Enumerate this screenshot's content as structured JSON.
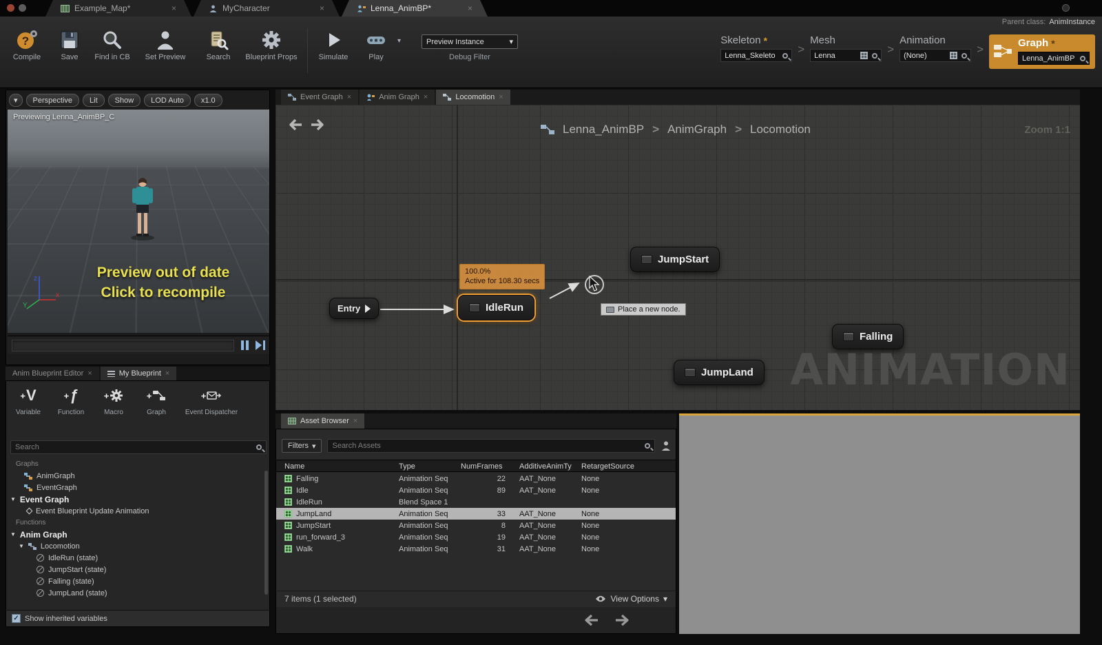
{
  "glyphs": {
    "close": "×",
    "caret": "▾",
    "expand": "▼",
    "chevron": ">",
    "asterisk": "*",
    "check": "✓"
  },
  "colors": {
    "accent_orange": "#cf8c2f",
    "node_active_border": "#ef9e36",
    "warning_yellow": "#e8e04e",
    "selected_row_gray": "#b5b5b5",
    "asset_icon_green": "#2e6b2e"
  },
  "window": {
    "tabs": [
      {
        "label": "Example_Map*"
      },
      {
        "label": "MyCharacter"
      },
      {
        "label": "Lenna_AnimBP*"
      }
    ],
    "parent_class_label": "Parent class:",
    "parent_class_value": "AnimInstance"
  },
  "toolbar": {
    "buttons": [
      "Compile",
      "Save",
      "Find in CB",
      "Set Preview",
      "Search",
      "Blueprint Props",
      "Simulate",
      "Play"
    ],
    "preview_instance": "Preview Instance",
    "debug_filter": "Debug Filter",
    "chain": {
      "skeleton": {
        "label": "Skeleton",
        "value": "Lenna_Skeleto"
      },
      "mesh": {
        "label": "Mesh",
        "value": "Lenna"
      },
      "animation": {
        "label": "Animation",
        "value": "(None)"
      },
      "graph": {
        "label": "Graph",
        "value": "Lenna_AnimBP"
      }
    }
  },
  "viewport": {
    "buttons": [
      "Perspective",
      "Lit",
      "Show",
      "LOD Auto",
      "x1.0"
    ],
    "previewing": "Previewing Lenna_AnimBP_C",
    "warning_line1": "Preview out of date",
    "warning_line2": "Click to recompile",
    "axis": {
      "x": "x",
      "y": "Y",
      "z": "z"
    }
  },
  "myblueprint": {
    "tabs": [
      "Anim Blueprint Editor",
      "My Blueprint"
    ],
    "actions": [
      "Variable",
      "Function",
      "Macro",
      "Graph",
      "Event Dispatcher"
    ],
    "action_glyphs": {
      "variable": "V",
      "function": "ƒ"
    },
    "search_placeholder": "Search",
    "tree": [
      {
        "label": "Graphs"
      },
      {
        "label": "AnimGraph"
      },
      {
        "label": "EventGraph"
      },
      {
        "label": "Event Graph"
      },
      {
        "label": "Event Blueprint Update Animation"
      },
      {
        "label": "Functions"
      },
      {
        "label": "Anim Graph"
      },
      {
        "label": "Locomotion"
      },
      {
        "label": "IdleRun (state)"
      },
      {
        "label": "JumpStart (state)"
      },
      {
        "label": "Falling (state)"
      },
      {
        "label": "JumpLand (state)"
      }
    ],
    "show_inherited": "Show inherited variables"
  },
  "graph": {
    "tabs": [
      "Event Graph",
      "Anim Graph",
      "Locomotion"
    ],
    "breadcrumb": {
      "items": [
        "Lenna_AnimBP",
        "AnimGraph",
        "Locomotion"
      ]
    },
    "zoom": "Zoom 1:1",
    "nodes": {
      "entry": "Entry",
      "idlerun": "IdleRun",
      "jumpstart": "JumpStart",
      "falling": "Falling",
      "jumpland": "JumpLand"
    },
    "active_tooltip": {
      "percent": "100.0%",
      "detail": "Active for 108.30 secs"
    },
    "place_node_tip": "Place a new node.",
    "watermark": "ANIMATION"
  },
  "asset_browser": {
    "tab": "Asset Browser",
    "filters_label": "Filters",
    "search_placeholder": "Search Assets",
    "columns": [
      "Name",
      "Type",
      "NumFrames",
      "AdditiveAnimTy",
      "RetargetSource"
    ],
    "rows": [
      {
        "name": "Falling",
        "type": "Animation Seq",
        "frames": "22",
        "additive": "AAT_None",
        "retarget": "None"
      },
      {
        "name": "Idle",
        "type": "Animation Seq",
        "frames": "89",
        "additive": "AAT_None",
        "retarget": "None"
      },
      {
        "name": "IdleRun",
        "type": "Blend Space 1",
        "frames": "",
        "additive": "",
        "retarget": ""
      },
      {
        "name": "JumpLand",
        "type": "Animation Seq",
        "frames": "33",
        "additive": "AAT_None",
        "retarget": "None"
      },
      {
        "name": "JumpStart",
        "type": "Animation Seq",
        "frames": "8",
        "additive": "AAT_None",
        "retarget": "None"
      },
      {
        "name": "run_forward_3",
        "type": "Animation Seq",
        "frames": "19",
        "additive": "AAT_None",
        "retarget": "None"
      },
      {
        "name": "Walk",
        "type": "Animation Seq",
        "frames": "31",
        "additive": "AAT_None",
        "retarget": "None"
      }
    ],
    "footer": "7 items (1 selected)",
    "view_options": "View Options"
  }
}
